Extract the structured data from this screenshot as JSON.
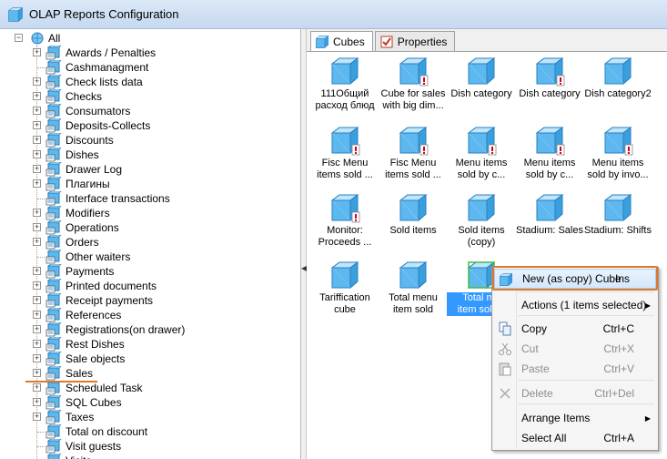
{
  "window": {
    "title": "OLAP Reports Configuration"
  },
  "tree": {
    "root_label": "All",
    "items": [
      {
        "label": "Awards / Penalties",
        "expandable": true
      },
      {
        "label": "Cashmanagment",
        "expandable": false
      },
      {
        "label": "Check lists data",
        "expandable": true
      },
      {
        "label": "Checks",
        "expandable": true
      },
      {
        "label": "Consumators",
        "expandable": true
      },
      {
        "label": "Deposits-Collects",
        "expandable": true
      },
      {
        "label": "Discounts",
        "expandable": true
      },
      {
        "label": "Dishes",
        "expandable": true
      },
      {
        "label": "Drawer Log",
        "expandable": true
      },
      {
        "label": "Плагины",
        "expandable": true
      },
      {
        "label": "Interface transactions",
        "expandable": false
      },
      {
        "label": "Modifiers",
        "expandable": true
      },
      {
        "label": "Operations",
        "expandable": true
      },
      {
        "label": "Orders",
        "expandable": true
      },
      {
        "label": "Other waiters",
        "expandable": false
      },
      {
        "label": "Payments",
        "expandable": true
      },
      {
        "label": "Printed documents",
        "expandable": true
      },
      {
        "label": "Receipt payments",
        "expandable": true
      },
      {
        "label": "References",
        "expandable": true
      },
      {
        "label": "Registrations(on drawer)",
        "expandable": true
      },
      {
        "label": "Rest Dishes",
        "expandable": true
      },
      {
        "label": "Sale objects",
        "expandable": true
      },
      {
        "label": "Sales",
        "expandable": true
      },
      {
        "label": "Scheduled Task",
        "expandable": true
      },
      {
        "label": "SQL Cubes",
        "expandable": true
      },
      {
        "label": "Taxes",
        "expandable": true
      },
      {
        "label": "Total on discount",
        "expandable": false
      },
      {
        "label": "Visit guests",
        "expandable": false
      },
      {
        "label": "Visits",
        "expandable": false
      }
    ]
  },
  "tabs": [
    {
      "label": "Cubes",
      "active": true
    },
    {
      "label": "Properties",
      "active": false
    }
  ],
  "cubes": [
    {
      "line1": "111Общий",
      "line2": "расход блюд",
      "badge": false
    },
    {
      "line1": "Cube for sales",
      "line2": "with big dim...",
      "badge": true
    },
    {
      "line1": "Dish category",
      "line2": "",
      "badge": false
    },
    {
      "line1": "Dish category",
      "line2": "",
      "badge": true
    },
    {
      "line1": "Dish category2",
      "line2": "",
      "badge": false
    },
    {
      "line1": "Fisc Menu",
      "line2": "items sold ...",
      "badge": true
    },
    {
      "line1": "Fisc Menu",
      "line2": "items sold ...",
      "badge": true
    },
    {
      "line1": "Menu items",
      "line2": "sold by c...",
      "badge": true
    },
    {
      "line1": "Menu items",
      "line2": "sold by c...",
      "badge": true
    },
    {
      "line1": "Menu items",
      "line2": "sold by invo...",
      "badge": true
    },
    {
      "line1": "Monitor:",
      "line2": "Proceeds ...",
      "badge": true
    },
    {
      "line1": "Sold items",
      "line2": "",
      "badge": false
    },
    {
      "line1": "Sold items",
      "line2": "(copy)",
      "badge": false
    },
    {
      "line1": "Stadium: Sales",
      "line2": "",
      "badge": false
    },
    {
      "line1": "Stadium: Shifts",
      "line2": "",
      "badge": false
    },
    {
      "line1": "Tariffication",
      "line2": "cube",
      "badge": false
    },
    {
      "line1": "Total menu",
      "line2": "item sold",
      "badge": false
    },
    {
      "line1": "Total me",
      "line2": "item sold c",
      "badge": false,
      "selected": true
    }
  ],
  "context_menu": {
    "items": [
      {
        "label": "New (as copy) Cube",
        "shortcut": "Ins",
        "enabled": true,
        "icon": "cube-icon",
        "highlight": true
      },
      {
        "label": "Actions (1 items selected)",
        "shortcut": "",
        "enabled": true,
        "submenu": true
      },
      {
        "label": "Copy",
        "shortcut": "Ctrl+C",
        "enabled": true,
        "icon": "copy-icon"
      },
      {
        "label": "Cut",
        "shortcut": "Ctrl+X",
        "enabled": false,
        "icon": "scissors-icon"
      },
      {
        "label": "Paste",
        "shortcut": "Ctrl+V",
        "enabled": false,
        "icon": "paste-icon"
      },
      {
        "label": "Delete",
        "shortcut": "Ctrl+Del",
        "enabled": false,
        "icon": "delete-icon"
      },
      {
        "label": "Arrange Items",
        "shortcut": "",
        "enabled": true,
        "submenu": true
      },
      {
        "label": "Select All",
        "shortcut": "Ctrl+A",
        "enabled": true
      }
    ]
  },
  "colors": {
    "accent_highlight": "#e0782a",
    "selection": "#3399ff",
    "cube_fill": "#55b6ee"
  }
}
